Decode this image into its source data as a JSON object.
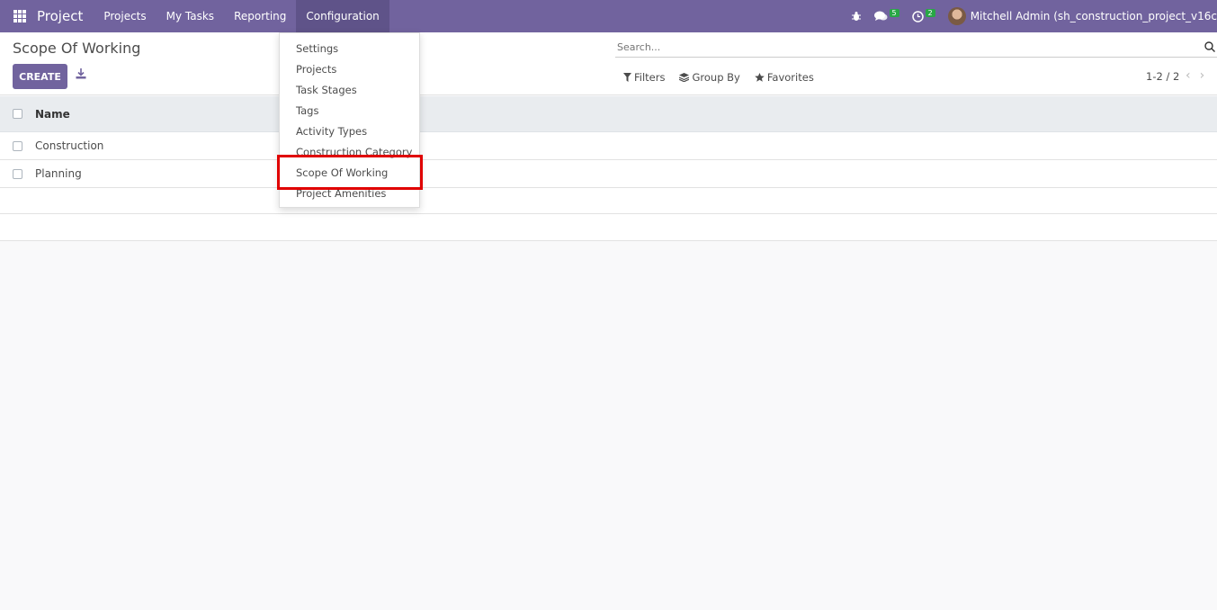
{
  "navbar": {
    "brand": "Project",
    "menus": [
      "Projects",
      "My Tasks",
      "Reporting",
      "Configuration"
    ],
    "messages_count": "5",
    "activities_count": "2",
    "user": "Mitchell Admin (sh_construction_project_v16c"
  },
  "control_panel": {
    "title": "Scope Of Working",
    "create_label": "CREATE",
    "search_placeholder": "Search...",
    "filters_label": "Filters",
    "groupby_label": "Group By",
    "favorites_label": "Favorites",
    "pager": "1-2 / 2"
  },
  "table": {
    "header": "Name",
    "rows": [
      "Construction",
      "Planning"
    ]
  },
  "dropdown": {
    "items": [
      "Settings",
      "Projects",
      "Task Stages",
      "Tags",
      "Activity Types",
      "Construction Category",
      "Scope Of Working",
      "Project Amenities"
    ]
  },
  "colors": {
    "brand": "#71639e",
    "highlight": "#e00000",
    "badge": "#28a745"
  }
}
